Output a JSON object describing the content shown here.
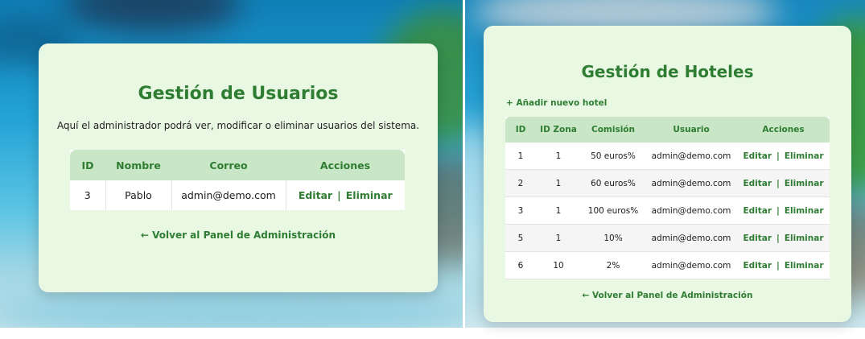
{
  "users_panel": {
    "title": "Gestión de Usuarios",
    "description": "Aquí el administrador podrá ver, modificar o eliminar usuarios del sistema.",
    "columns": [
      "ID",
      "Nombre",
      "Correo",
      "Acciones"
    ],
    "rows": [
      {
        "id": "3",
        "nombre": "Pablo",
        "correo": "admin@demo.com"
      }
    ],
    "edit_label": "Editar",
    "delete_label": "Eliminar",
    "separator": "|",
    "back_link": "← Volver al Panel de Administración"
  },
  "hotels_panel": {
    "title": "Gestión de Hoteles",
    "add_link": "+ Añadir nuevo hotel",
    "columns": [
      "ID",
      "ID Zona",
      "Comisión",
      "Usuario",
      "Acciones"
    ],
    "rows": [
      {
        "id": "1",
        "zona": "1",
        "comision": "50 euros%",
        "usuario": "admin@demo.com"
      },
      {
        "id": "2",
        "zona": "1",
        "comision": "60 euros%",
        "usuario": "admin@demo.com"
      },
      {
        "id": "3",
        "zona": "1",
        "comision": "100 euros%",
        "usuario": "admin@demo.com"
      },
      {
        "id": "5",
        "zona": "1",
        "comision": "10%",
        "usuario": "admin@demo.com"
      },
      {
        "id": "6",
        "zona": "10",
        "comision": "2%",
        "usuario": "admin@demo.com"
      }
    ],
    "edit_label": "Editar",
    "delete_label": "Eliminar",
    "separator": "|",
    "back_link": "← Volver al Panel de Administración"
  },
  "colors": {
    "accent": "#2e7d32",
    "card_bg": "#e8f8e3",
    "header_bg": "#c9e7c6"
  }
}
